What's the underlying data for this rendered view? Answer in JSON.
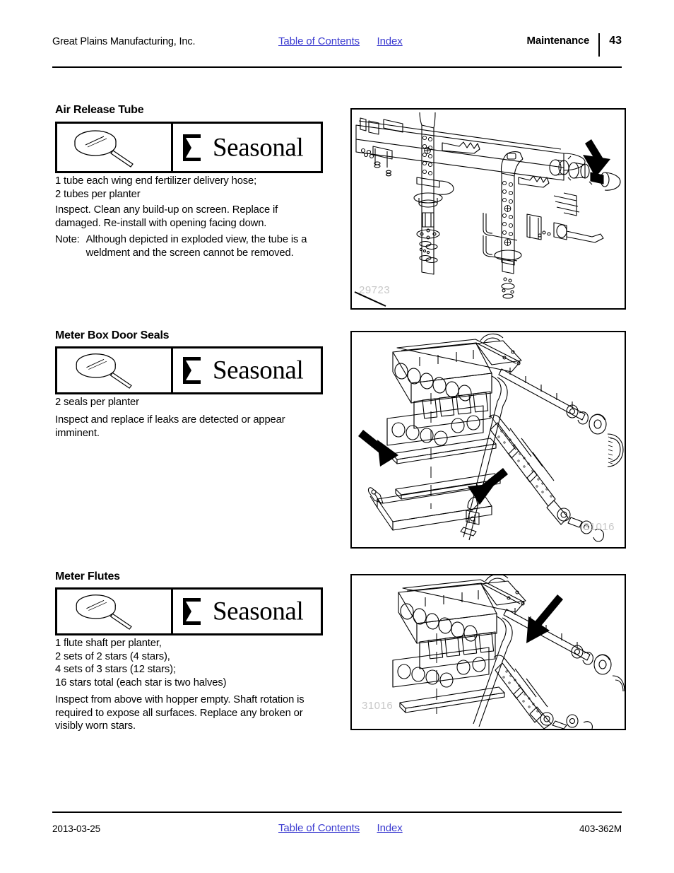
{
  "header": {
    "company": "Great Plains Manufacturing, Inc.",
    "toc_link": "Table of Contents",
    "index_link": "Index",
    "section": "Maintenance",
    "page_number": "43"
  },
  "sections": [
    {
      "title": "Air Release Tube",
      "inspect_icon": "magnifier-icon",
      "interval_icon": "hourglass-icon",
      "interval_label": "Seasonal",
      "quantity": "1 tube each wing end fertilizer delivery hose;\n2 tubes per planter",
      "instructions": "Inspect. Clean any build-up on screen. Replace if damaged. Re-install with opening facing down.",
      "note_label": "Note:",
      "note_text": "Although depicted in exploded view, the tube is a weldment and the screen cannot be removed.",
      "figure_label": "29723"
    },
    {
      "title": "Meter Box Door Seals",
      "inspect_icon": "magnifier-icon",
      "interval_icon": "hourglass-icon",
      "interval_label": "Seasonal",
      "quantity": "2 seals per planter",
      "instructions": "Inspect and replace if leaks are detected or appear imminent.",
      "figure_label": "31016"
    },
    {
      "title": "Meter Flutes",
      "inspect_icon": "magnifier-icon",
      "interval_icon": "hourglass-icon",
      "interval_label": "Seasonal",
      "quantity": "1 flute shaft per planter,\n2 sets of 2 stars (4 stars),\n4 sets of 3 stars (12 stars);\n16 stars total (each star is two halves)",
      "instructions": "Inspect from above with hopper empty. Shaft rotation is required to expose all surfaces. Replace any broken or visibly worn stars.",
      "figure_label": "31016"
    }
  ],
  "footer": {
    "date": "2013-03-25",
    "toc_link": "Table of Contents",
    "index_link": "Index",
    "doc_number": "403-362M"
  },
  "colors": {
    "link": "#3a3ad0",
    "text": "#000000",
    "figure_label": "#c8c8c8"
  }
}
